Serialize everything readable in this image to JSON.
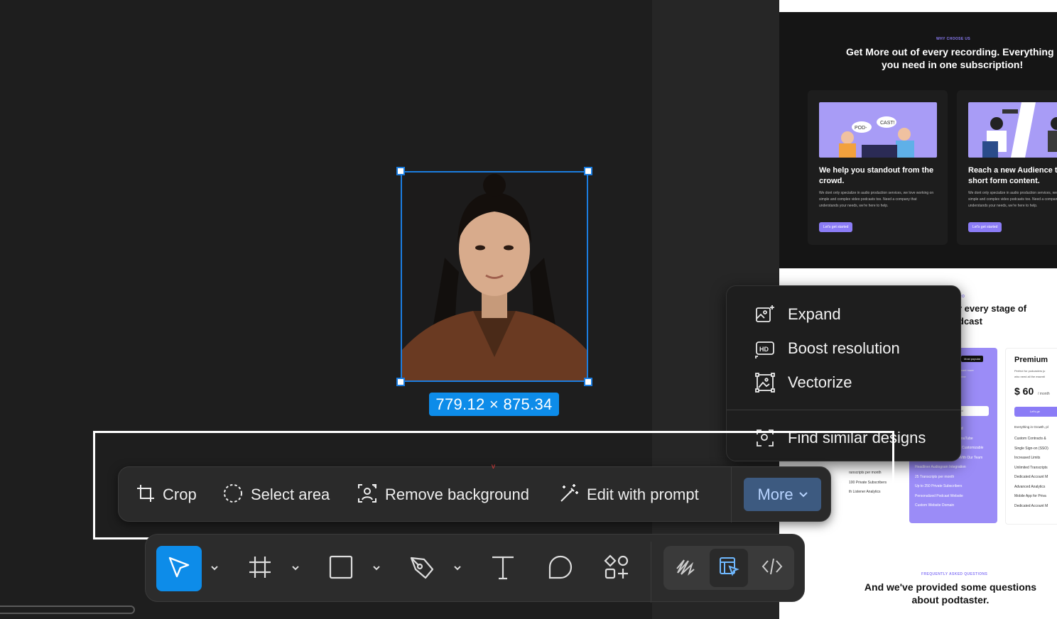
{
  "canvas": {
    "selection_dimensions": "779.12 × 875.34"
  },
  "site_preview": {
    "why_eyebrow": "WHY CHOOSE US",
    "headline_line1": "Get More out of every recording. Everything",
    "headline_line2": "you need in one subscription!",
    "cards": [
      {
        "title_line1": "We help you standout from the",
        "title_line2": "crowd.",
        "body": "We dont only specialize in audio production services, we love working on simple and complex video podcasts too. Need a company that understands your needs, we're here to help.",
        "button": "Let's get started",
        "bubble1": "POD-",
        "bubble2": "CAST!"
      },
      {
        "title_line1": "Reach a new Audience th",
        "title_line2": "short form content.",
        "body": "We dont only specialize in audio production services, we love working on simple and complex video podcasts too. Need a company that understands your needs, we're here to help.",
        "button": "Let's get started"
      }
    ],
    "plans_eyebrow": "RO",
    "plans_line1": "r every stage of",
    "plans_line2": "dcast",
    "mid_badge": "Most popular",
    "mid_sub": "want more",
    "mid_sub2": "nine",
    "mid_btn": "ted",
    "mid_features": [
      "nd",
      "YouTube",
      "n Customizable",
      "",
      "With Our Team",
      "Headliner Audiogram Integration",
      "25 Transcripts per month",
      "Up to 250 Private Subscribers",
      "Personalized Podcast Website",
      "Custom Website Domain"
    ],
    "left_features": [
      "ranscripts per month",
      "100 Private Subscribers",
      "th Listener Analytics"
    ],
    "premium": {
      "name": "Premium",
      "desc_line1": "Perfect for podcasters ju",
      "desc_line2": "who need all the essenti",
      "price": "$ 60",
      "per": "/ month",
      "button": "Let's ge",
      "features_head": "Everything in Growth, pl",
      "features": [
        "Custom Contracts &",
        "Single Sign-on (SSO)",
        "Increased Limits",
        "Unlimited Transcripts",
        "Dedicated Account M",
        "Advanced Analytics",
        "Mobile App for Priva",
        "Dedicated Account M"
      ]
    },
    "faq_eyebrow": "FREQUENTLY ASKED QUESTIONS",
    "faq_line1": "And we've provided some questions",
    "faq_line2": "about podtaster."
  },
  "more_menu": {
    "items": [
      {
        "label": "Expand",
        "icon": "expand-image-icon"
      },
      {
        "label": "Boost resolution",
        "icon": "hd-icon"
      },
      {
        "label": "Vectorize",
        "icon": "vectorize-icon"
      },
      {
        "label": "Find similar designs",
        "icon": "find-similar-icon"
      }
    ]
  },
  "context_toolbar": {
    "crop": "Crop",
    "select_area": "Select area",
    "remove_background": "Remove background",
    "edit_with_prompt": "Edit with prompt",
    "more": "More"
  },
  "tool_bar": {
    "tools": [
      "move",
      "frame",
      "shape",
      "pen",
      "text",
      "comment",
      "actions"
    ],
    "modes": [
      "draw",
      "design",
      "dev"
    ],
    "active_tool": "move",
    "active_mode": "design"
  },
  "colors": {
    "accent": "#0d8ce9",
    "more_button": "#3d5a80",
    "site_purple": "#8b7cf6"
  }
}
